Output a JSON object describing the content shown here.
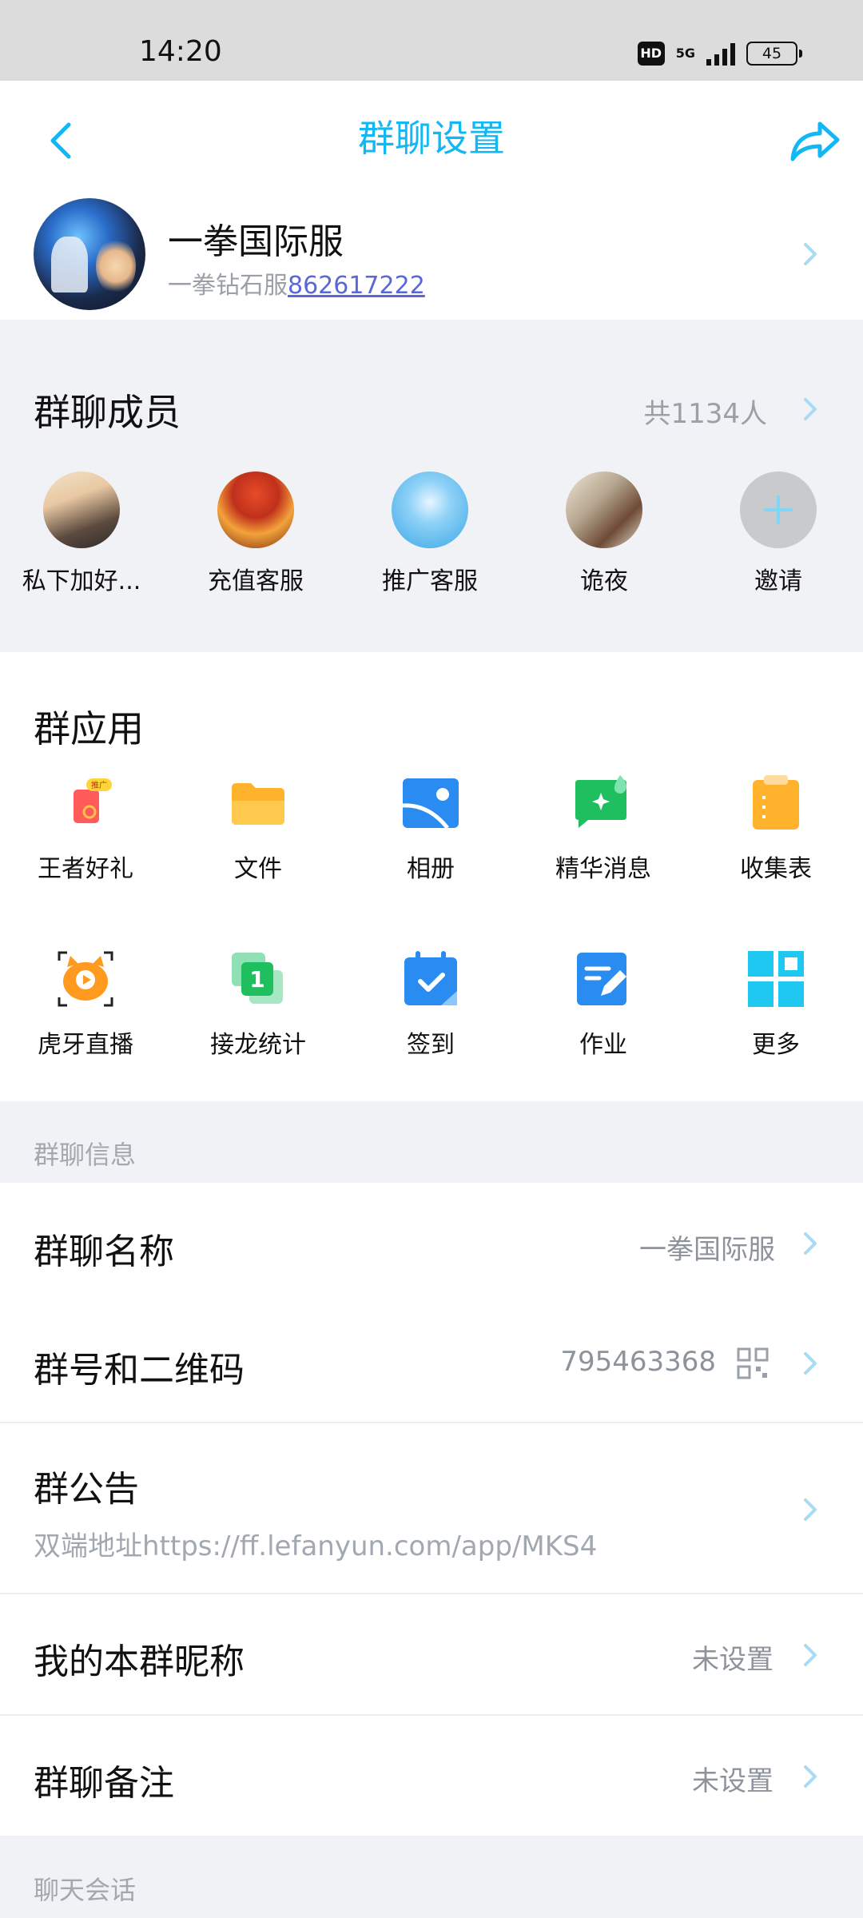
{
  "status": {
    "time": "14:20",
    "hd": "HD",
    "network": "5G",
    "battery": "45"
  },
  "header": {
    "title": "群聊设置"
  },
  "group": {
    "name": "一拳国际服",
    "sub_prefix": "一拳钻石服",
    "sub_number": "862617222"
  },
  "members": {
    "title": "群聊成员",
    "count": "共1134人",
    "items": [
      {
        "name": "私下加好..."
      },
      {
        "name": "充值客服"
      },
      {
        "name": "推广客服"
      },
      {
        "name": "诡夜"
      },
      {
        "name": "邀请"
      }
    ]
  },
  "apps": {
    "title": "群应用",
    "items": [
      {
        "label": "王者好礼",
        "badge": "推广"
      },
      {
        "label": "文件"
      },
      {
        "label": "相册"
      },
      {
        "label": "精华消息"
      },
      {
        "label": "收集表"
      },
      {
        "label": "虎牙直播"
      },
      {
        "label": "接龙统计",
        "badge": "1"
      },
      {
        "label": "签到"
      },
      {
        "label": "作业"
      },
      {
        "label": "更多"
      }
    ]
  },
  "info": {
    "section": "群聊信息",
    "name_label": "群聊名称",
    "name_value": "一拳国际服",
    "qr_label": "群号和二维码",
    "qr_value": "795463368",
    "notice_label": "群公告",
    "notice_value": "双端地址https://ff.lefanyun.com/app/MKS4",
    "nickname_label": "我的本群昵称",
    "nickname_value": "未设置",
    "remark_label": "群聊备注",
    "remark_value": "未设置"
  },
  "chat": {
    "section": "聊天会话"
  },
  "colors": {
    "accent": "#12b7f5",
    "link": "#5a67d8",
    "muted": "#9aa0a8"
  }
}
